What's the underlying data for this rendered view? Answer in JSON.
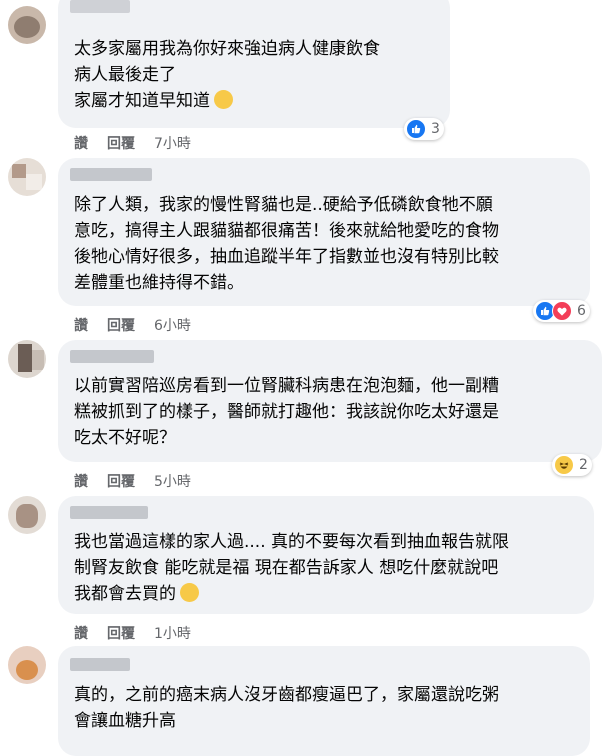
{
  "comments": [
    {
      "lines": [
        "太多家屬用我為你好來強迫病人健康飲食",
        "病人最後走了",
        "家屬才知道早知道"
      ],
      "emoji": "crying-face-emoji",
      "actions": {
        "like": "讚",
        "reply": "回覆",
        "time": "7小時"
      },
      "reactions": {
        "types": [
          "like"
        ],
        "count": "3"
      }
    },
    {
      "lines": [
        "除了人類，我家的慢性腎貓也是..硬給予低磷飲食牠不願",
        "意吃，搞得主人跟貓貓都很痛苦！後來就給牠愛吃的食物",
        "後牠心情好很多，抽血追蹤半年了指數並也沒有特別比較",
        "差體重也維持得不錯。"
      ],
      "actions": {
        "like": "讚",
        "reply": "回覆",
        "time": "6小時"
      },
      "reactions": {
        "types": [
          "like",
          "love"
        ],
        "count": "6"
      }
    },
    {
      "lines": [
        "以前實習陪巡房看到一位腎臟科病患在泡泡麵，他一副糟",
        "糕被抓到了的樣子，醫師就打趣他：我該說你吃太好還是",
        "吃太不好呢？"
      ],
      "actions": {
        "like": "讚",
        "reply": "回覆",
        "time": "5小時"
      },
      "reactions": {
        "types": [
          "haha"
        ],
        "count": "2"
      }
    },
    {
      "lines": [
        "我也當過這樣的家人過.... 真的不要每次看到抽血報告就限",
        "制腎友飲食 能吃就是福 現在都告訴家人 想吃什麼就說吧",
        "我都會去買的"
      ],
      "emoji": "relieved-face-emoji",
      "actions": {
        "like": "讚",
        "reply": "回覆",
        "time": "1小時"
      }
    },
    {
      "lines": [
        "真的，之前的癌末病人沒牙齒都瘦逼巴了，家屬還說吃粥",
        "會讓血糖升高"
      ]
    }
  ],
  "colors": {
    "bubble": "#f0f2f5",
    "text": "#050505",
    "meta": "#65676b",
    "like": "#1877f2",
    "love": "#f33e58",
    "haha": "#f7c948"
  }
}
